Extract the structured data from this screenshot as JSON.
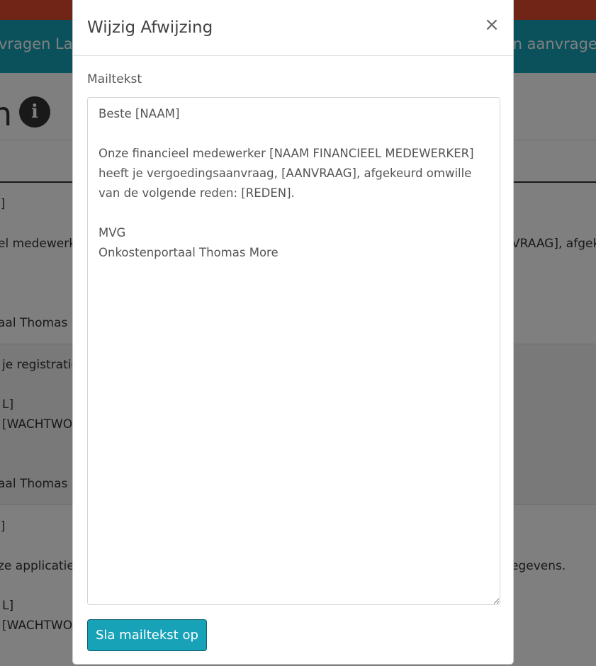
{
  "nav": {
    "link_left_1": "vragen",
    "link_left_2": "La",
    "link_right": "ijn aanvrage"
  },
  "background": {
    "title_fragment": "n",
    "info_icon_glyph": "i",
    "rows": [
      {
        "line1": "l]",
        "line2": "el medewerk",
        "line2_right": "VRAAG], afgek",
        "line3": "aal Thomas"
      },
      {
        "line1": "je registratie",
        "line2": "L]",
        "line3": "[WACHTWO",
        "line4": "aal Thomas"
      },
      {
        "line1": "l]",
        "line2": "ze applicatie",
        "line2_right": "egevens.",
        "line3": "L]",
        "line4": "[WACHTWO"
      }
    ]
  },
  "modal": {
    "title": "Wijzig Afwijzing",
    "close_glyph": "×",
    "field_label": "Mailtekst",
    "mail_text": "Beste [NAAM]\n\nOnze financieel medewerker [NAAM FINANCIEEL MEDEWERKER] heeft je vergoedingsaanvraag, [AANVRAAG], afgekeurd omwille van de volgende reden: [REDEN].\n\nMVG\nOnkostenportaal Thomas More",
    "save_label": "Sla mailtekst op"
  },
  "colors": {
    "accent": "#17a2b8",
    "topbar": "#e24a2c",
    "backdrop": "rgba(0,0,0,0.5)"
  }
}
